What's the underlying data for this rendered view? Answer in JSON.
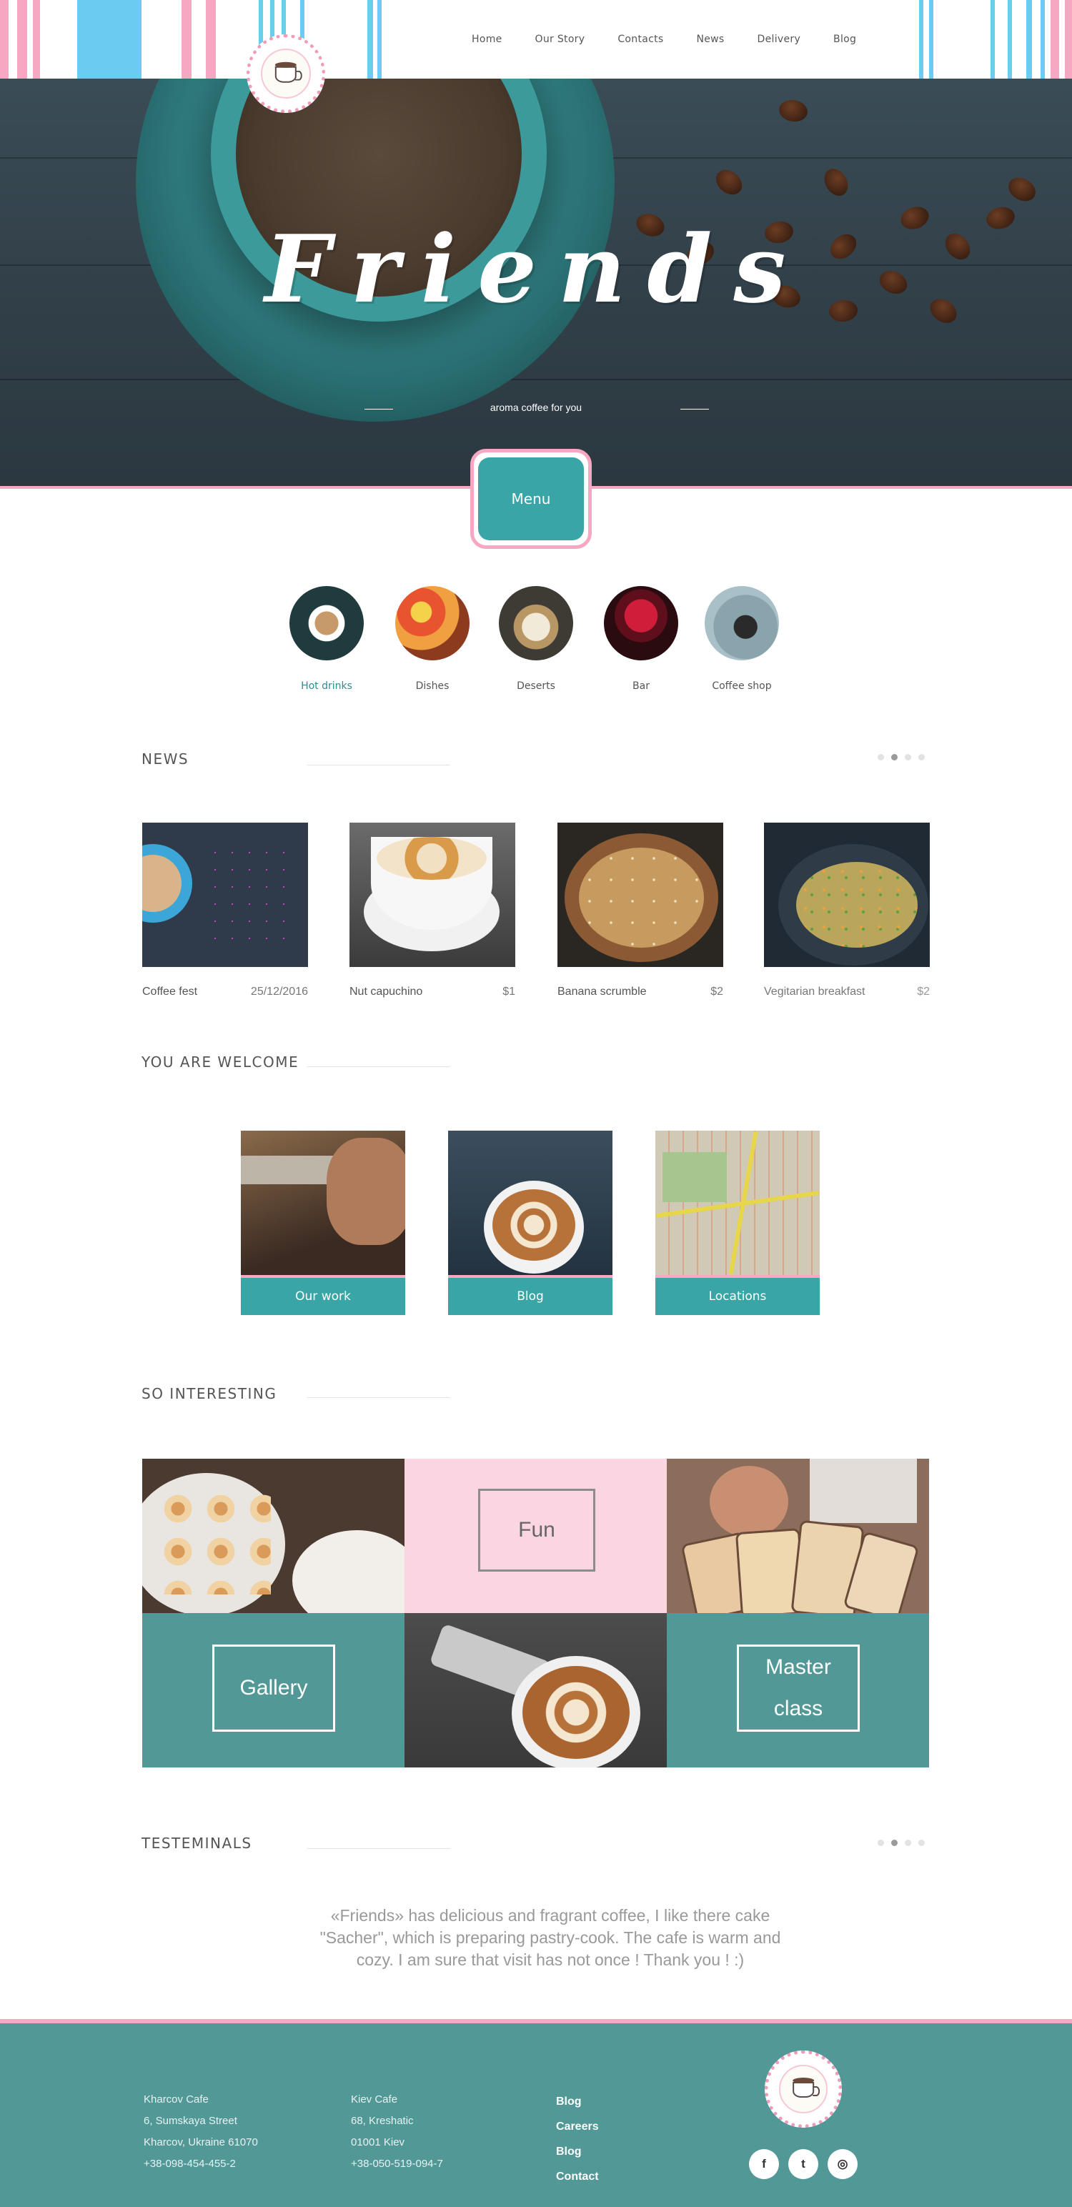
{
  "nav": {
    "items": [
      "Home",
      "Our Story",
      "Contacts",
      "News",
      "Delivery",
      "Blog"
    ]
  },
  "hero": {
    "title": "Friends",
    "subtitle": "aroma coffee for you"
  },
  "menu_badge": {
    "label": "Menu"
  },
  "categories": [
    {
      "label": "Hot drinks"
    },
    {
      "label": "Dishes"
    },
    {
      "label": "Deserts"
    },
    {
      "label": "Bar"
    },
    {
      "label": "Coffee shop"
    }
  ],
  "news": {
    "title": "NEWS",
    "items": [
      {
        "name": "Coffee fest",
        "value": "25/12/2016"
      },
      {
        "name": "Nut capuchino",
        "value": "$1"
      },
      {
        "name": "Banana scrumble",
        "value": "$2"
      },
      {
        "name": "Vegitarian breakfast",
        "value": "$2"
      }
    ]
  },
  "welcome": {
    "title": "YOU ARE WELCOME",
    "items": [
      "Our work",
      "Blog",
      "Locations"
    ]
  },
  "interesting": {
    "title": "SO INTERESTING",
    "fun": "Fun",
    "gallery": "Gallery",
    "master_class": "Master class"
  },
  "testimonials": {
    "title": "TESTEMINALS",
    "quote": "«Friends» has delicious and fragrant coffee, I like there cake \"Sacher\", which is preparing pastry-cook. The cafe is warm and cozy. I am sure that  visit has not once ! Thank you ! :)"
  },
  "footer": {
    "cafe1": [
      "Kharcov Cafe",
      "6, Sumskaya Street",
      "Kharcov, Ukraine 61070",
      "+38-098-454-455-2"
    ],
    "cafe2": [
      "Kiev Cafe",
      "68, Kreshatic",
      "01001 Kiev",
      "+38-050-519-094-7"
    ],
    "links": [
      "Blog",
      "Careers",
      "Blog",
      "Contact"
    ],
    "social": [
      "f",
      "t",
      "◎"
    ]
  },
  "colors": {
    "teal": "#3aa5a6",
    "pink": "#f6a7c1",
    "footer": "#529897"
  }
}
